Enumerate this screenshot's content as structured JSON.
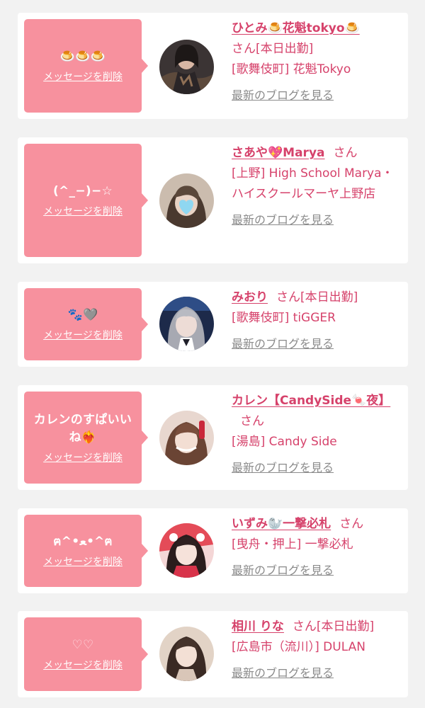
{
  "delete_label": "メッセージを削除",
  "blog_label": "最新のブログを見る",
  "honorific": "さん",
  "colors": {
    "background": "#f2f2f2",
    "bubble": "#f7919e",
    "accent": "#d6426b",
    "link_gray": "#8b8b8b"
  },
  "entries": [
    {
      "message": "🍮🍮🍮",
      "name": "ひとみ🍮花魁tokyo🍮",
      "status": "[本日出勤]",
      "shop": "[歌舞伎町] 花魁Tokyo"
    },
    {
      "message": "(^_−)−☆",
      "name": "さあや💖Marya",
      "status": "",
      "shop": "[上野] High School Marya・ハイスクールマーヤ上野店"
    },
    {
      "message": "🐾🩶",
      "name": "みおり",
      "status": "[本日出勤]",
      "shop": "[歌舞伎町] tiGGER"
    },
    {
      "message": "カレンのすぱいいね❤️‍🔥",
      "name": "カレン【CandySide🍬夜】",
      "status": "",
      "shop": "[湯島] Candy Side"
    },
    {
      "message": "ฅ^•ﻌ•^ฅ",
      "name": "いずみ🦭一撃必札",
      "status": "",
      "shop": "[曳舟・押上] 一撃必札"
    },
    {
      "message": "♡♡",
      "name": "相川 りな",
      "status": "[本日出勤]",
      "shop": "[広島市（流川）] DULAN"
    }
  ]
}
